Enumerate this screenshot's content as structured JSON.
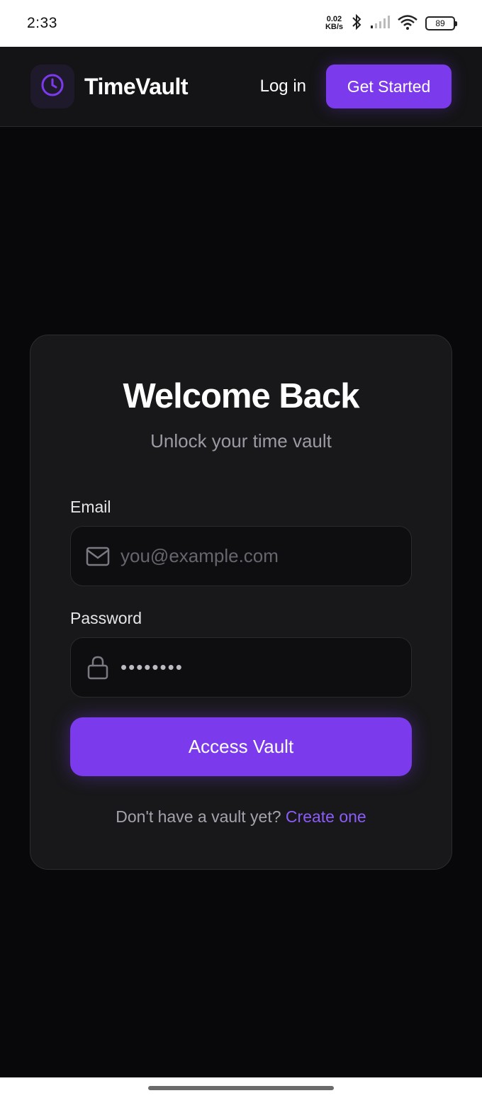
{
  "status_bar": {
    "time": "2:33",
    "net_speed_value": "0.02",
    "net_speed_unit": "KB/s",
    "battery": "89"
  },
  "navbar": {
    "brand": "TimeVault",
    "login_label": "Log in",
    "get_started_label": "Get Started"
  },
  "login_card": {
    "title": "Welcome Back",
    "subtitle": "Unlock your time vault",
    "email_label": "Email",
    "email_placeholder": "you@example.com",
    "password_label": "Password",
    "password_value": "••••••••",
    "submit_label": "Access Vault",
    "signup_prompt": "Don't have a vault yet?",
    "signup_link": "Create one"
  },
  "colors": {
    "accent": "#7c3aed",
    "background": "#08080a",
    "card": "#18181a"
  }
}
